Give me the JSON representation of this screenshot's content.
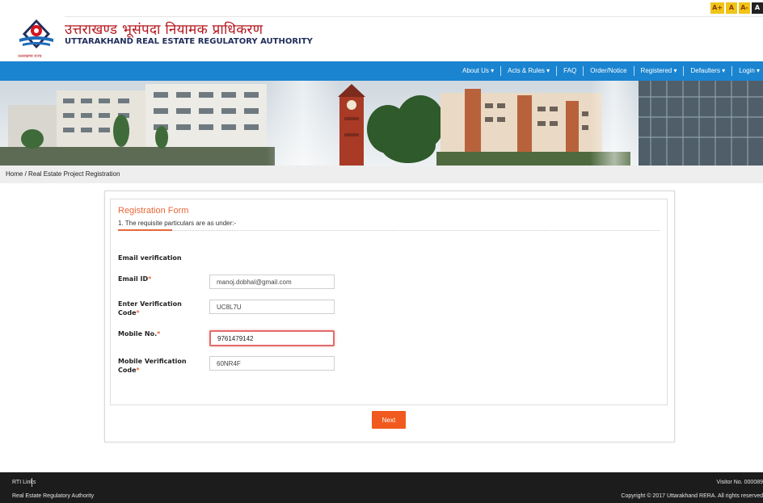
{
  "font_controls": [
    "A+",
    "A",
    "A-",
    "A"
  ],
  "header": {
    "title_hindi": "उत्तराखण्ड भूसंपदा नियामक प्राधिकरण",
    "title_english": "UTTARAKHAND REAL ESTATE REGULATORY AUTHORITY",
    "logo_caption": "उत्तराखण्ड राज्य"
  },
  "nav": {
    "items": [
      "About Us ▾",
      "Acts & Rules ▾",
      "FAQ",
      "Order/Notice",
      "Registered ▾",
      "Defaulters ▾",
      "Login ▾"
    ]
  },
  "breadcrumb": {
    "home": "Home",
    "separator": " / ",
    "current": "Real Estate Project Registration"
  },
  "form": {
    "title": "Registration Form",
    "subtitle": "1. The requisite particulars are as under:-",
    "section": "Email verification",
    "required_mark": "*",
    "fields": [
      {
        "label": "Email ID",
        "value": "manoj.dobhal@gmail.com"
      },
      {
        "label": "Enter Verification Code",
        "value": "UC8L7U"
      },
      {
        "label": "Mobile No.",
        "value": "9761479142"
      },
      {
        "label": "Mobile Verification Code",
        "value": "60NR4F"
      }
    ],
    "next_label": "Next"
  },
  "footer": {
    "rti": "RTI Links",
    "org": "Real Estate Regulatory Authority",
    "visitor": "Visitor No. 000089",
    "copyright": "Copyright © 2017 Uttarakhand RERA. All rights reserved"
  },
  "colors": {
    "navbar": "#1a84d0",
    "accent": "#e8683a",
    "button": "#f05a1e",
    "title_red": "#b5151c",
    "footer": "#1c1c1c"
  }
}
